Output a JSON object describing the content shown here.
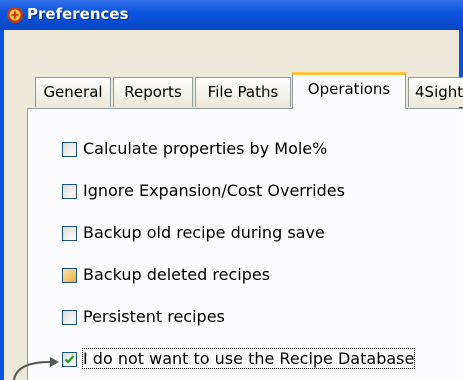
{
  "window": {
    "title": "Preferences",
    "accent": "#0a53dc",
    "icon": "app-logo-icon"
  },
  "tabs": [
    {
      "label": "General",
      "active": false
    },
    {
      "label": "Reports",
      "active": false
    },
    {
      "label": "File Paths",
      "active": false
    },
    {
      "label": "Operations",
      "active": true
    },
    {
      "label": "4Sight",
      "active": false
    }
  ],
  "options": [
    {
      "label": "Calculate properties by Mole%",
      "checked": false
    },
    {
      "label": "Ignore Expansion/Cost Overrides",
      "checked": false
    },
    {
      "label": "Backup old recipe during save",
      "checked": false
    },
    {
      "label": "Backup deleted recipes",
      "checked": false
    },
    {
      "label": "Persistent recipes",
      "checked": false
    },
    {
      "label": "I do not want to use the Recipe Database",
      "checked": true
    }
  ],
  "annotation": {
    "icon": "callout-arrow-icon"
  }
}
